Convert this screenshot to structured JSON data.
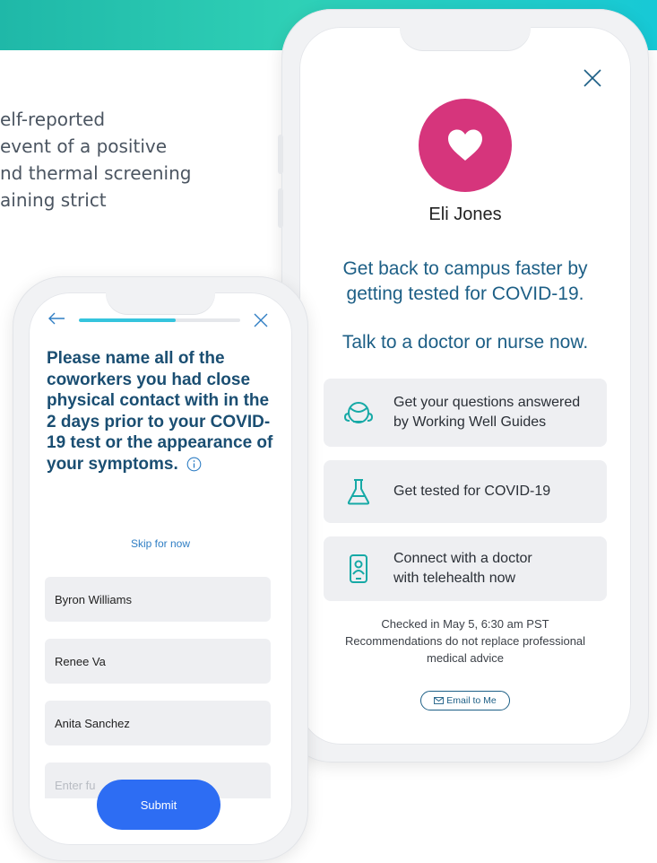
{
  "background": {
    "lines": [
      "elf-reported",
      "event of a positive",
      "nd thermal screening",
      "aining strict"
    ]
  },
  "right_phone": {
    "user_name": "Eli Jones",
    "headline_line1": "Get back to campus faster by",
    "headline_line2": "getting tested for COVID-19.",
    "talk_prompt": "Talk to a doctor or nurse now.",
    "options": [
      {
        "line1": "Get your questions answered",
        "line2": "by Working Well Guides",
        "icon": "headset-icon"
      },
      {
        "line1": "Get tested for COVID-19",
        "line2": "",
        "icon": "flask-icon"
      },
      {
        "line1": "Connect with a doctor",
        "line2": "with telehealth now",
        "icon": "phone-doctor-icon"
      }
    ],
    "checked_in": "Checked in May 5, 6:30 am PST",
    "disclaimer_line1": "Recommendations do not replace professional",
    "disclaimer_line2": "medical advice",
    "email_label": "Email to Me"
  },
  "left_phone": {
    "progress_percent": 60,
    "question": "Please name all of the coworkers you had close physical contact with in the 2 days prior to your COVID-19 test or the appearance of your symptoms.",
    "skip_label": "Skip for now",
    "names": [
      "Byron Williams",
      "Renee Va",
      "Anita Sanchez"
    ],
    "name_placeholder": "Enter fu",
    "submit_label": "Submit"
  },
  "colors": {
    "accent_teal": "#2fd0b6",
    "heart_pink": "#d6357c",
    "heading_blue": "#1d5f86",
    "submit_blue": "#2d6df3",
    "progress_cyan": "#35c4dd"
  }
}
